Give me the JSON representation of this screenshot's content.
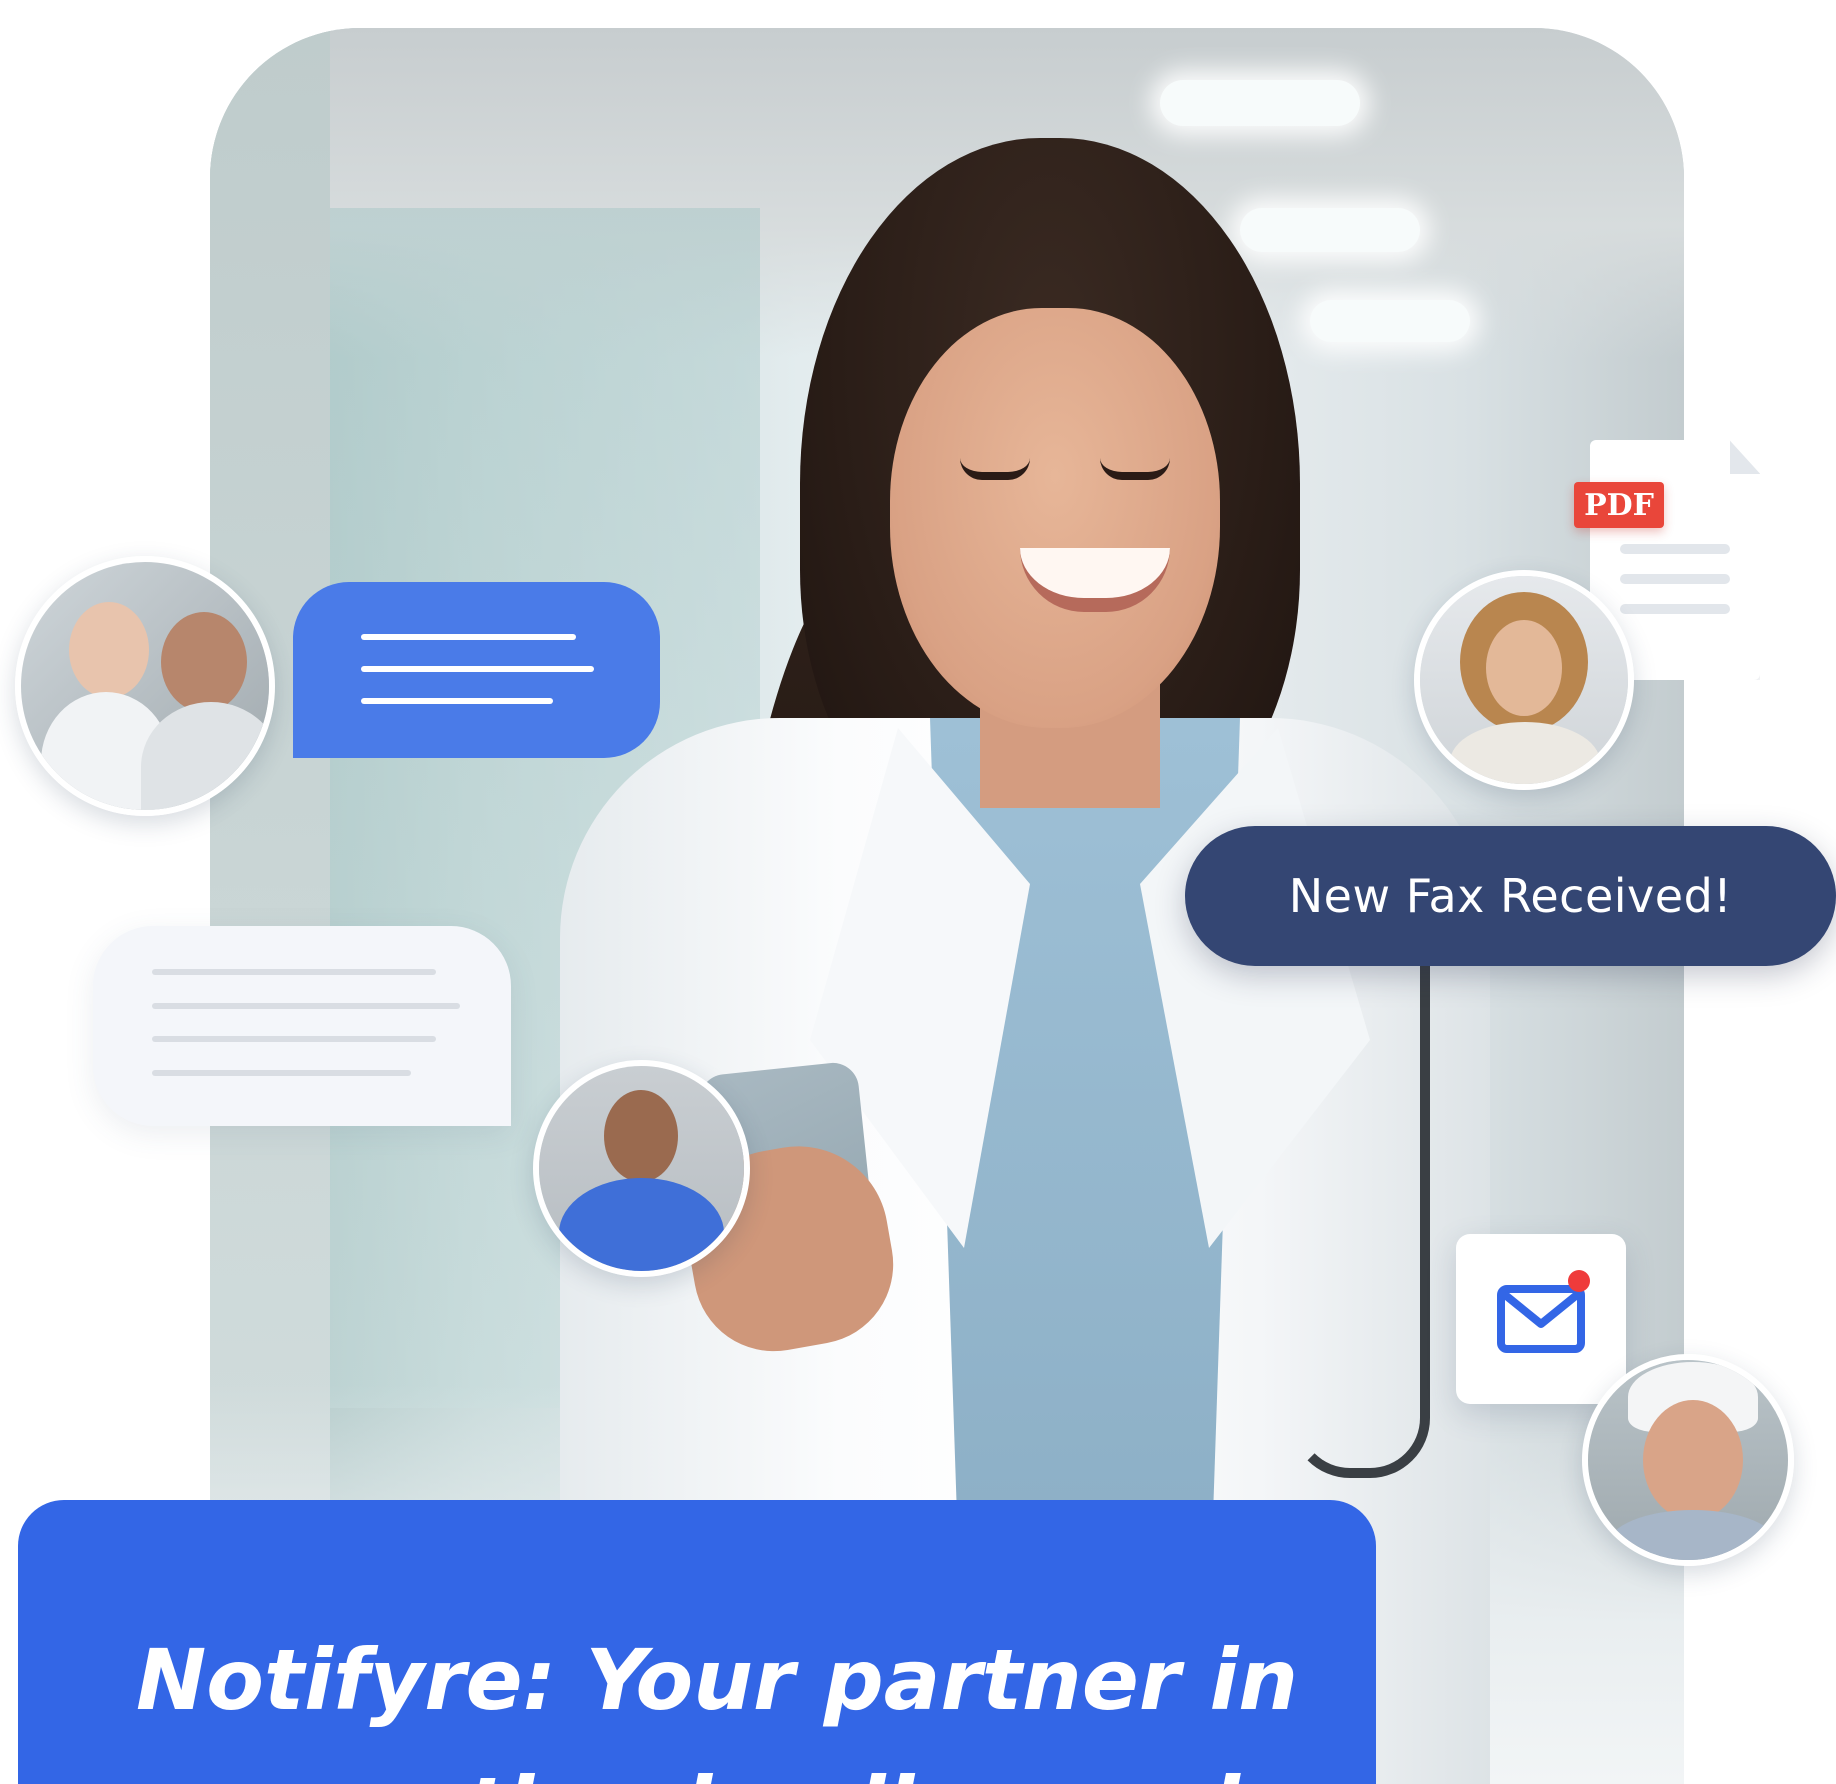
{
  "notification": {
    "fax_label": "New Fax Received!"
  },
  "document": {
    "badge": "PDF"
  },
  "headline": {
    "line1": "Notifyre: Your partner in",
    "line2": "supporting healing and a"
  },
  "colors": {
    "primary_blue": "#3366e6",
    "bubble_blue": "#4a7be8",
    "navy": "#344673",
    "pdf_red": "#e9463a",
    "notification_dot": "#ef3b3b"
  },
  "icons": {
    "mail": "envelope-icon",
    "pdf": "pdf-file-icon"
  }
}
